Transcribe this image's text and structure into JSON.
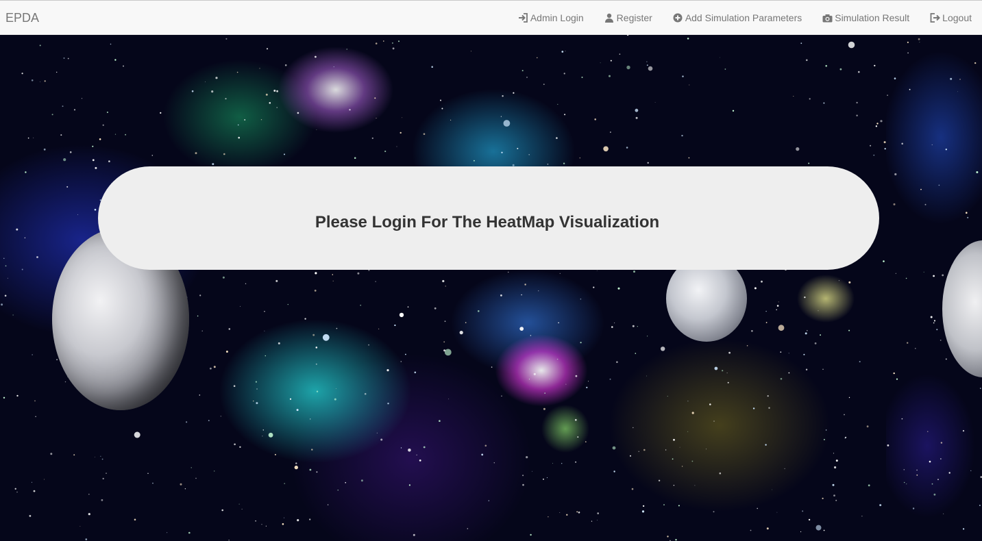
{
  "navbar": {
    "brand": "EPDA",
    "items": [
      {
        "label": "Admin Login",
        "icon": "login-icon"
      },
      {
        "label": "Register",
        "icon": "user-icon"
      },
      {
        "label": "Add Simulation Parameters",
        "icon": "plus-circle-icon"
      },
      {
        "label": "Simulation Result",
        "icon": "camera-icon"
      },
      {
        "label": "Logout",
        "icon": "logout-icon"
      }
    ]
  },
  "hero": {
    "message": "Please Login For The HeatMap Visualization"
  },
  "colors": {
    "navbar_bg": "#f8f8f8",
    "nav_text": "#777777",
    "panel_bg": "#eeeeee",
    "panel_text": "#333333",
    "space_bg": "#05061a"
  }
}
